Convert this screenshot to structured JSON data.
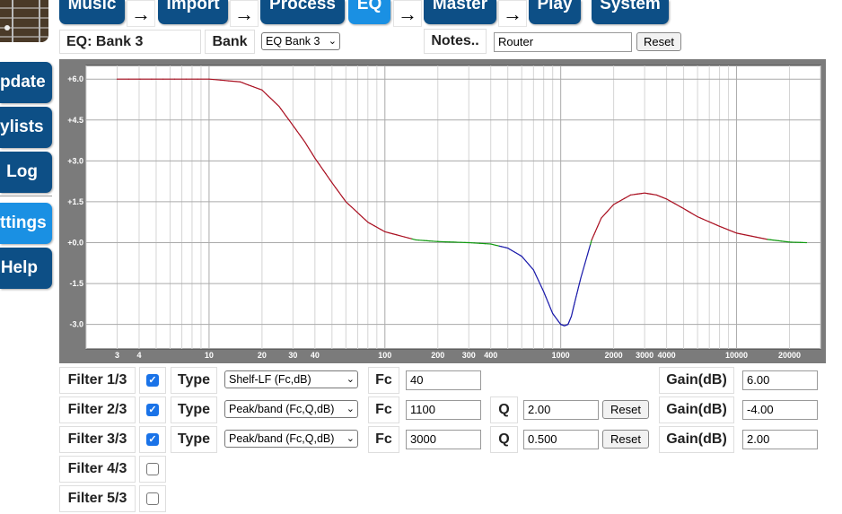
{
  "nav": {
    "tabs": [
      {
        "label": "Music",
        "active": false
      },
      {
        "label": "Import",
        "active": false
      },
      {
        "label": "Process",
        "active": false
      },
      {
        "label": "EQ",
        "active": true
      },
      {
        "label": "Master",
        "active": false
      },
      {
        "label": "Play",
        "active": false
      },
      {
        "label": "System",
        "active": false
      }
    ],
    "arrow": "→"
  },
  "sidebar": {
    "items": [
      {
        "label": "pdate",
        "active": false
      },
      {
        "label": "ylists",
        "active": false
      },
      {
        "label": "Log",
        "active": false
      },
      {
        "label": "ttings",
        "active": true
      },
      {
        "label": "Help",
        "active": false
      }
    ]
  },
  "header": {
    "eq_title": "EQ: Bank 3",
    "bank_label": "Bank",
    "bank_select": "EQ Bank 3",
    "notes_label": "Notes..",
    "notes_value": "Router",
    "reset_label": "Reset"
  },
  "chart_data": {
    "type": "line",
    "xscale": "log",
    "xlim": [
      2,
      30000
    ],
    "ylim": [
      -3.9,
      6.5
    ],
    "x_ticks": [
      {
        "v": 3,
        "label": "3"
      },
      {
        "v": 4,
        "label": "4"
      },
      {
        "v": 10,
        "label": "10"
      },
      {
        "v": 20,
        "label": "20"
      },
      {
        "v": 30,
        "label": "30"
      },
      {
        "v": 40,
        "label": "40"
      },
      {
        "v": 100,
        "label": "100"
      },
      {
        "v": 200,
        "label": "200"
      },
      {
        "v": 300,
        "label": "300"
      },
      {
        "v": 400,
        "label": "400"
      },
      {
        "v": 1000,
        "label": "1000"
      },
      {
        "v": 2000,
        "label": "2000"
      },
      {
        "v": 3000,
        "label": "3000"
      },
      {
        "v": 4000,
        "label": "4000"
      },
      {
        "v": 10000,
        "label": "10000"
      },
      {
        "v": 20000,
        "label": "20000"
      }
    ],
    "y_ticks": [
      {
        "v": 6,
        "label": "+6.0"
      },
      {
        "v": 4.5,
        "label": "+4.5"
      },
      {
        "v": 3,
        "label": "+3.0"
      },
      {
        "v": 1.5,
        "label": "+1.5"
      },
      {
        "v": 0,
        "label": "+0.0"
      },
      {
        "v": -1.5,
        "label": "-1.5"
      },
      {
        "v": -3,
        "label": "-3.0"
      }
    ],
    "grid": true,
    "colors": {
      "positive": "#aa1122",
      "flat": "#119911",
      "negative": "#1a1aaa"
    },
    "series": [
      {
        "x": [
          3,
          10,
          15,
          20,
          25,
          30,
          35,
          40,
          50,
          60,
          80,
          100,
          150,
          200,
          300,
          400,
          500,
          600,
          700,
          800,
          900,
          1000,
          1050,
          1100,
          1150,
          1200,
          1300,
          1500,
          1700,
          2000,
          2500,
          3000,
          3500,
          4000,
          5000,
          6000,
          8000,
          10000,
          15000,
          20000,
          25000
        ],
        "y": [
          6.0,
          6.0,
          5.9,
          5.6,
          5.0,
          4.3,
          3.7,
          3.1,
          2.2,
          1.5,
          0.75,
          0.4,
          0.1,
          0.04,
          0.0,
          -0.05,
          -0.2,
          -0.5,
          -1.0,
          -1.8,
          -2.6,
          -3.0,
          -3.05,
          -3.0,
          -2.7,
          -2.2,
          -1.3,
          0.1,
          0.9,
          1.4,
          1.75,
          1.82,
          1.75,
          1.6,
          1.25,
          0.95,
          0.6,
          0.35,
          0.12,
          0.02,
          0.0
        ]
      }
    ]
  },
  "filters": [
    {
      "label": "Filter 1/3",
      "enabled": true,
      "type_label": "Type",
      "type_value": "Shelf-LF (Fc,dB)",
      "fc_label": "Fc",
      "fc": "40",
      "q_label": "",
      "q": "",
      "reset_label": "",
      "gain_label": "Gain(dB)",
      "gain": "6.00"
    },
    {
      "label": "Filter 2/3",
      "enabled": true,
      "type_label": "Type",
      "type_value": "Peak/band (Fc,Q,dB)",
      "fc_label": "Fc",
      "fc": "1100",
      "q_label": "Q",
      "q": "2.00",
      "reset_label": "Reset",
      "gain_label": "Gain(dB)",
      "gain": "-4.00"
    },
    {
      "label": "Filter 3/3",
      "enabled": true,
      "type_label": "Type",
      "type_value": "Peak/band (Fc,Q,dB)",
      "fc_label": "Fc",
      "fc": "3000",
      "q_label": "Q",
      "q": "0.500",
      "reset_label": "Reset",
      "gain_label": "Gain(dB)",
      "gain": "2.00"
    },
    {
      "label": "Filter 4/3",
      "enabled": false
    },
    {
      "label": "Filter 5/3",
      "enabled": false
    }
  ]
}
